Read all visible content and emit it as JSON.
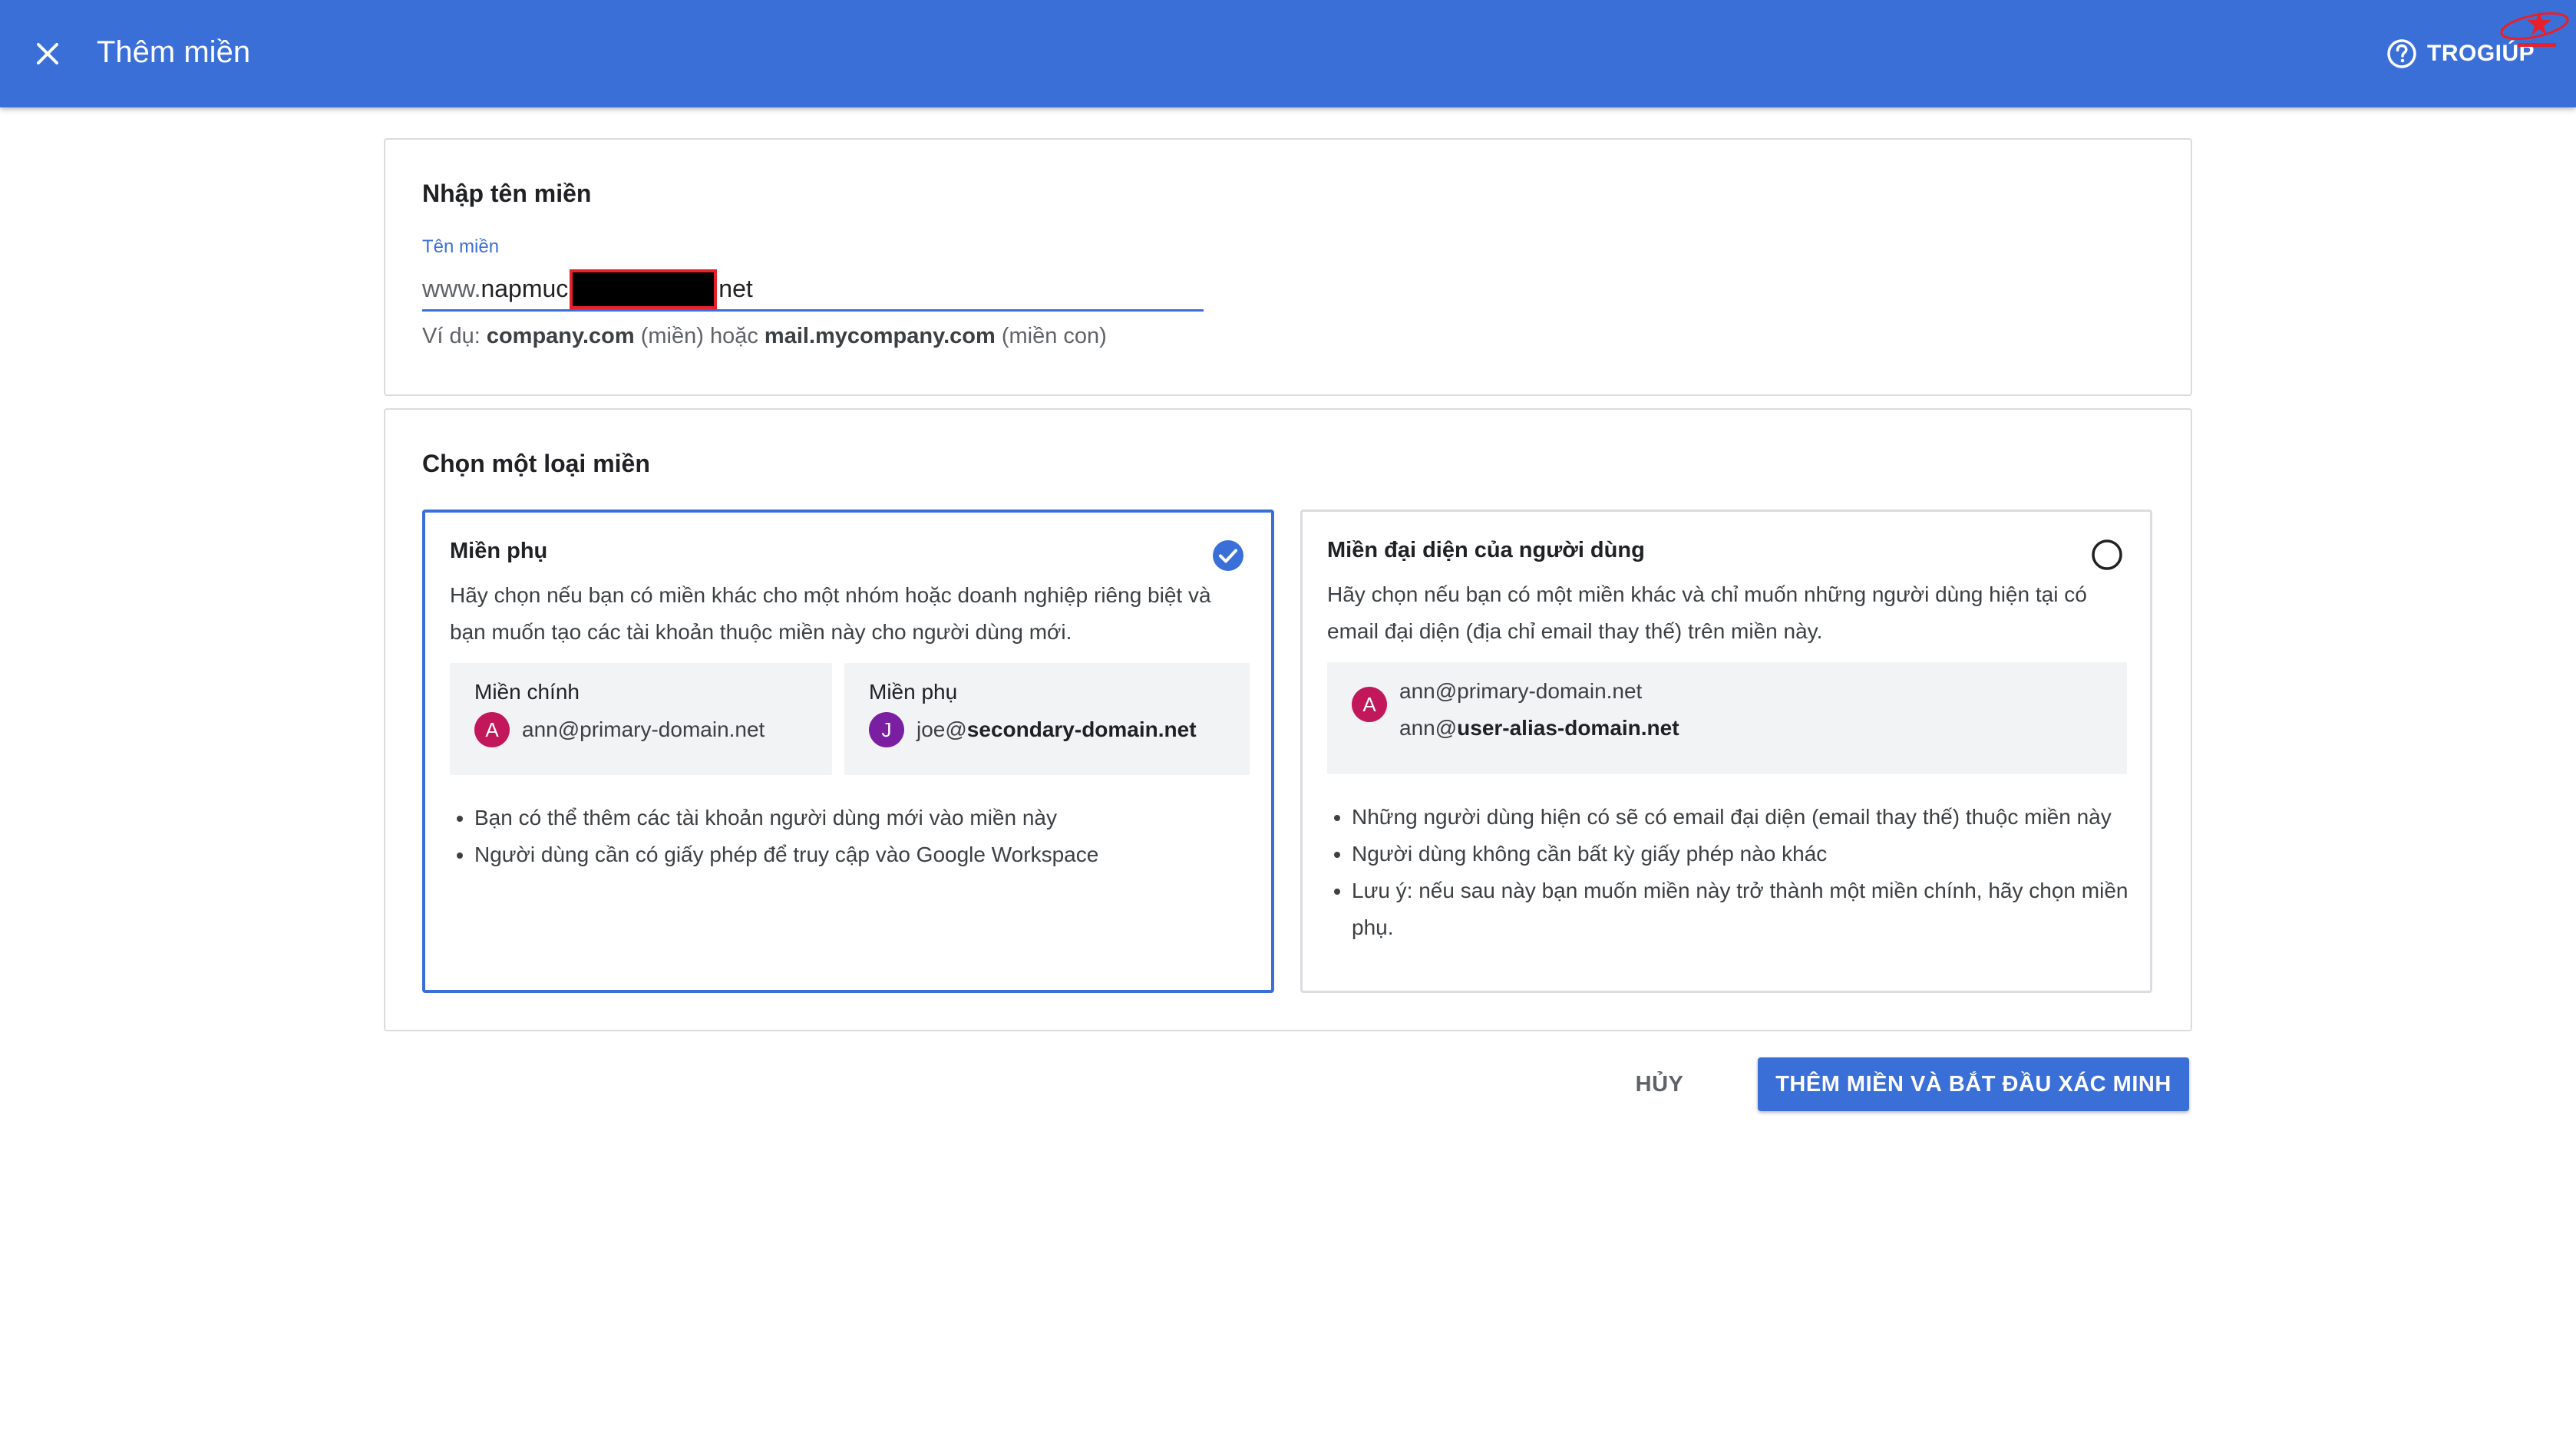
{
  "header": {
    "title": "Thêm miền",
    "help_label": "TROGIÚP"
  },
  "domain_card": {
    "title": "Nhập tên miền",
    "field_label": "Tên miền",
    "field_prefix": "www.",
    "field_value": "napmuc",
    "field_suffix": "net",
    "hint_prefix": "Ví dụ: ",
    "hint_example1": "company.com",
    "hint_middle": " (miền) hoặc ",
    "hint_example2": "mail.mycompany.com",
    "hint_suffix": " (miền con)"
  },
  "type_card": {
    "title": "Chọn một loại miền",
    "options": [
      {
        "title": "Miền phụ",
        "selected": true,
        "description": "Hãy chọn nếu bạn có miền khác cho một nhóm hoặc doanh nghiệp riêng biệt và bạn muốn tạo các tài khoản thuộc miền này cho người dùng mới.",
        "primary_label": "Miền chính",
        "primary_avatar": "A",
        "primary_email": "ann@primary-domain.net",
        "secondary_label": "Miền phụ",
        "secondary_avatar": "J",
        "secondary_user": "joe@",
        "secondary_domain": "secondary-domain.net",
        "bullets": [
          "Bạn có thể thêm các tài khoản người dùng mới vào miền này",
          "Người dùng cần có giấy phép để truy cập vào Google Workspace"
        ]
      },
      {
        "title": "Miền đại diện của người dùng",
        "selected": false,
        "description": "Hãy chọn nếu bạn có một miền khác và chỉ muốn những người dùng hiện tại có email đại diện (địa chỉ email thay thế) trên miền này.",
        "avatar": "A",
        "email1": "ann@primary-domain.net",
        "email2_user": "ann@",
        "email2_domain": "user-alias-domain.net",
        "bullets": [
          "Những người dùng hiện có sẽ có email đại diện (email thay thế) thuộc miền này",
          "Người dùng không cần bất kỳ giấy phép nào khác",
          "Lưu ý: nếu sau này bạn muốn miền này trở thành một miền chính, hãy chọn miền phụ."
        ]
      }
    ]
  },
  "actions": {
    "cancel_label": "HỦY",
    "submit_label": "THÊM MIỀN VÀ BẮT ĐẦU XÁC MINH"
  },
  "colors": {
    "accent": "#3b6fd8",
    "avatar_a": "#c2185b",
    "avatar_j": "#7b1fa2",
    "redaction_border": "#e8202a"
  },
  "icons": {
    "close": "close-icon",
    "help": "help-circle-icon",
    "selected": "check-circle-icon",
    "unselected": "radio-empty-icon"
  }
}
